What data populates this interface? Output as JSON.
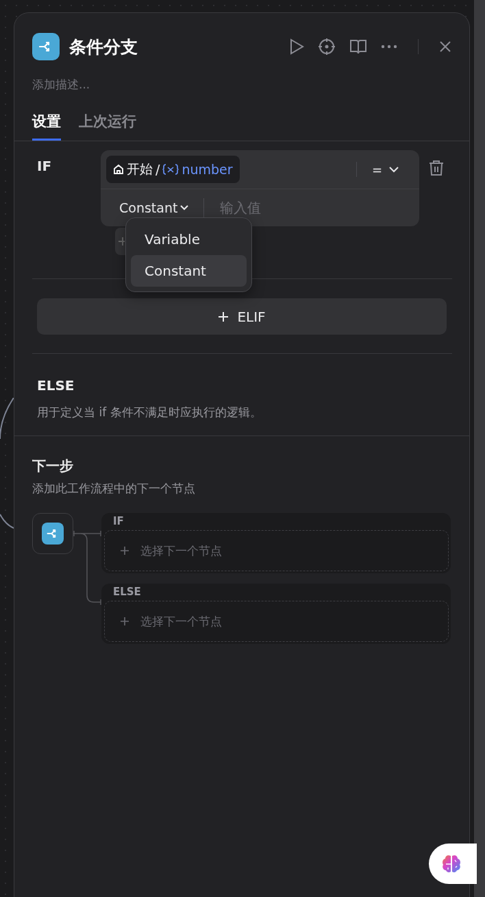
{
  "header": {
    "title": "条件分支",
    "description_placeholder": "添加描述..."
  },
  "tabs": [
    {
      "label": "设置",
      "selected": true
    },
    {
      "label": "上次运行",
      "selected": false
    }
  ],
  "if_block": {
    "label": "IF",
    "condition": {
      "source": "开始",
      "separator": "/",
      "variable": "number",
      "operator": "=",
      "value_type": "Constant",
      "value_placeholder": "输入值"
    },
    "value_type_menu": [
      {
        "label": "Variable",
        "selected": false
      },
      {
        "label": "Constant",
        "selected": true
      }
    ]
  },
  "elif_button": "ELIF",
  "else_block": {
    "title": "ELSE",
    "description": "用于定义当 if 条件不满足时应执行的逻辑。"
  },
  "next_step": {
    "title": "下一步",
    "subtitle": "添加此工作流程中的下一个节点",
    "branches": [
      {
        "label": "IF",
        "placeholder": "选择下一个节点"
      },
      {
        "label": "ELSE",
        "placeholder": "选择下一个节点"
      }
    ]
  }
}
